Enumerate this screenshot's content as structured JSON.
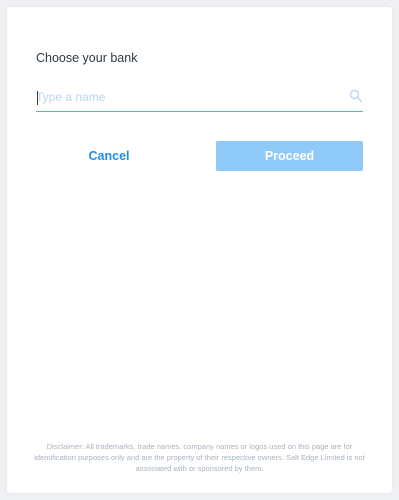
{
  "dialog": {
    "title": "Choose your bank"
  },
  "search": {
    "placeholder": "Type a name",
    "value": "",
    "icon": "search-icon"
  },
  "actions": {
    "cancel_label": "Cancel",
    "proceed_label": "Proceed"
  },
  "disclaimer": {
    "text": "Disclaimer: All trademarks, trade names, company names or logos used on this page are for identification purposes only and are the property of their respective owners. Salt Edge Limited is not associated with or sponsored by them."
  },
  "colors": {
    "accent": "#1f8ee6",
    "proceed_disabled": "#8ec9f7",
    "input_underline": "#5aa9ea",
    "background": "#eef0f3"
  }
}
